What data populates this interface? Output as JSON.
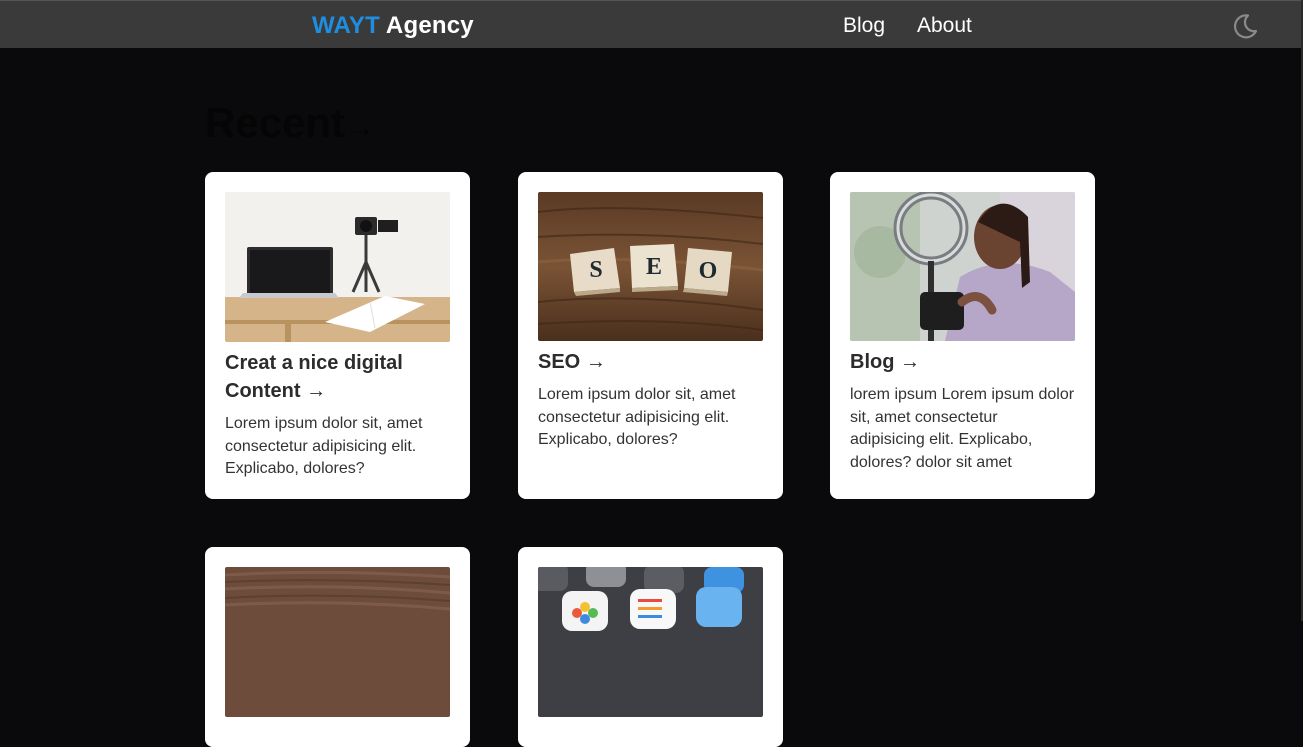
{
  "header": {
    "brand_accent": "WAYT",
    "brand_rest": "Agency",
    "nav": [
      {
        "label": "Blog"
      },
      {
        "label": "About"
      }
    ],
    "theme_toggle_icon": "moon-icon"
  },
  "main": {
    "section_title": "Recent",
    "section_arrow": "→",
    "cards": [
      {
        "title": "Creat a nice digital Content",
        "arrow": "→",
        "text": "Lorem ipsum dolor sit, amet consectetur adipisicing elit. Explicabo, dolores?",
        "image": "desk-laptop-camera-photo"
      },
      {
        "title": "SEO",
        "arrow": "→",
        "text": "Lorem ipsum dolor sit, amet consectetur adipisicing elit. Explicabo, dolores?",
        "image": "seo-tiles-photo",
        "image_tiles": [
          "S",
          "E",
          "O"
        ]
      },
      {
        "title": "Blog",
        "arrow": "→",
        "text": "lorem ipsum Lorem ipsum dolor sit, amet consectetur adipisicing elit. Explicabo, dolores? dolor sit amet",
        "image": "ring-light-vlogger-photo"
      },
      {
        "image": "wood-texture-photo"
      },
      {
        "image": "phone-app-icons-photo"
      }
    ]
  },
  "colors": {
    "background": "#0a0a0c",
    "header": "#3a3a3a",
    "brand_accent": "#1e8ee0",
    "card": "#ffffff"
  }
}
